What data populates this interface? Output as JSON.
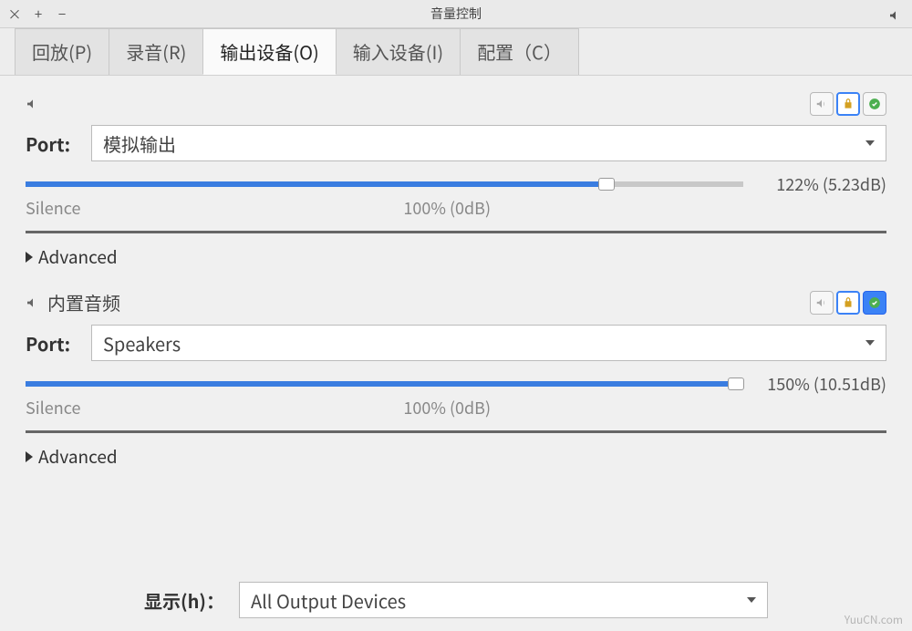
{
  "window": {
    "title": "音量控制"
  },
  "tabs": [
    {
      "label": "回放(P)"
    },
    {
      "label": "录音(R)"
    },
    {
      "label": "输出设备(O)",
      "active": true
    },
    {
      "label": "输入设备(I)"
    },
    {
      "label": "配置（C）"
    }
  ],
  "devices": [
    {
      "name": "",
      "port_label": "Port:",
      "port_value": "模拟输出",
      "volume_percent": 122,
      "volume_text": "122% (5.23dB)",
      "slider_fill_percent": 81,
      "scale_left": "Silence",
      "scale_mid": "100% (0dB)",
      "advanced_label": "Advanced",
      "default_active": false
    },
    {
      "name": "内置音频",
      "port_label": "Port:",
      "port_value": "Speakers",
      "volume_percent": 150,
      "volume_text": "150% (10.51dB)",
      "slider_fill_percent": 99,
      "scale_left": "Silence",
      "scale_mid": "100% (0dB)",
      "advanced_label": "Advanced",
      "default_active": true
    }
  ],
  "footer": {
    "label": "显示(h)：",
    "value": "All Output Devices"
  },
  "watermark": "YuuCN.com"
}
